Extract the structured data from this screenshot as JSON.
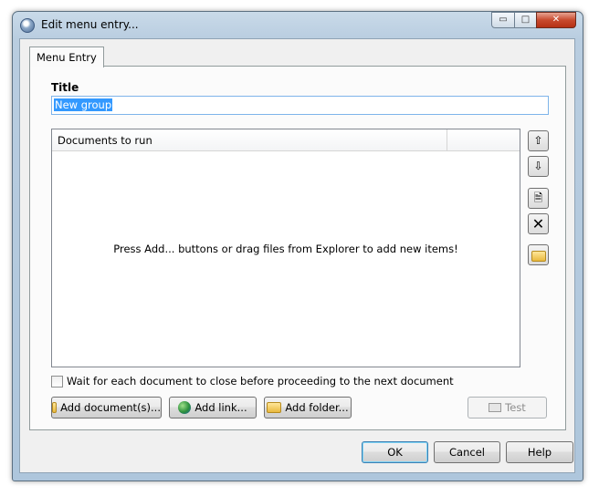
{
  "window": {
    "title": "Edit menu entry...",
    "caption_buttons": {
      "minimize": "▭",
      "maximize": "□",
      "close": "✕"
    }
  },
  "tabs": [
    {
      "label": "Menu Entry",
      "active": true
    }
  ],
  "form": {
    "title_label": "Title",
    "title_value": "New group"
  },
  "documents": {
    "column_header": "Documents to run",
    "empty_text": "Press Add... buttons or drag files from Explorer to add new items!"
  },
  "side_buttons": [
    {
      "name": "move-up",
      "icon": "arrow-up-icon",
      "glyph": "⇧"
    },
    {
      "name": "move-down",
      "icon": "arrow-down-icon",
      "glyph": "⇩"
    },
    {
      "name": "edit",
      "icon": "document-check-icon",
      "glyph": "🗎"
    },
    {
      "name": "remove",
      "icon": "delete-x-icon",
      "glyph": "✕"
    },
    {
      "name": "open-folder",
      "icon": "folder-icon",
      "glyph": ""
    }
  ],
  "checkbox": {
    "label": "Wait for each document to close before proceeding to the next document",
    "checked": false
  },
  "add_buttons": {
    "add_document": "Add document(s)...",
    "add_link": "Add link...",
    "add_folder": "Add folder...",
    "test": "Test"
  },
  "dialog_buttons": {
    "ok": "OK",
    "cancel": "Cancel",
    "help": "Help"
  },
  "colors": {
    "accent": "#3399ff",
    "frame": "#b9cde0",
    "close_button": "#c84a2e"
  }
}
